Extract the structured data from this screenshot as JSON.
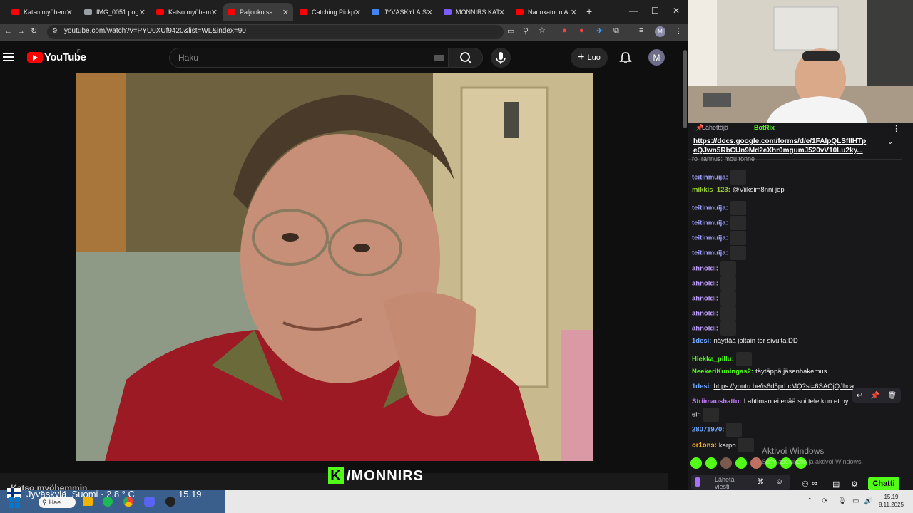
{
  "browser": {
    "tabs": [
      {
        "title": "Katso myöhemmin",
        "color": "#ff0000",
        "active": false
      },
      {
        "title": "IMG_0051.png",
        "color": "#9aa0a6",
        "active": false
      },
      {
        "title": "Katso myöhemmin",
        "color": "#ff0000",
        "active": false
      },
      {
        "title": "Paljonko sa",
        "color": "#ff0000",
        "active": true
      },
      {
        "title": "Catching Pickp",
        "color": "#ff0000",
        "active": false
      },
      {
        "title": "JYVÄSKYLÄ SÖ",
        "color": "#4285f4",
        "active": false
      },
      {
        "title": "MONNIRS KAT",
        "color": "#7b5cff",
        "active": false
      },
      {
        "title": "Narinkatorin A",
        "color": "#ff0000",
        "active": false
      }
    ],
    "url": "youtube.com/watch?v=PYU0XUf9420&list=WL&index=90",
    "profile_initial": "M"
  },
  "youtube": {
    "logo_text": "YouTube",
    "region": "FI",
    "search_placeholder": "Haku",
    "create_label": "Luo",
    "avatar_initial": "M",
    "watch_later_label": "Katso myöhemmin"
  },
  "overlay": {
    "brand_letter": "K",
    "channel_text": "/MONNIRS"
  },
  "chat": {
    "pinned_by_label": "Lähettäjä",
    "pinned_by_user": "BotRix",
    "pinned_link": "https://docs.google.com/forms/d/e/1FAIpQLSfIlHTp eQJwn5RbCUn9Md2eXhr0mgumJ520vV10Lu2ky...",
    "partial_line": "ro_rannus: mou tonne",
    "messages": [
      {
        "user": "teitinmuija:",
        "color": "#a0a0ff",
        "text": "",
        "emote": true
      },
      {
        "user": "mikkis_123:",
        "color": "#9acd32",
        "text": "@Viiksim8nni jep",
        "emote": false
      },
      {
        "user": "teitinmuija:",
        "color": "#a0a0ff",
        "text": "",
        "emote": true
      },
      {
        "user": "teitinmuija:",
        "color": "#a0a0ff",
        "text": "",
        "emote": true
      },
      {
        "user": "teitinmuija:",
        "color": "#a0a0ff",
        "text": "",
        "emote": true
      },
      {
        "user": "teitinmuija:",
        "color": "#a0a0ff",
        "text": "",
        "emote": true
      },
      {
        "user": "ahnoldi:",
        "color": "#c0a0ff",
        "text": "",
        "emote": true
      },
      {
        "user": "ahnoldi:",
        "color": "#c0a0ff",
        "text": "",
        "emote": true
      },
      {
        "user": "ahnoldi:",
        "color": "#c0a0ff",
        "text": "",
        "emote": true
      },
      {
        "user": "ahnoldi:",
        "color": "#c0a0ff",
        "text": "",
        "emote": true
      },
      {
        "user": "ahnoldi:",
        "color": "#c0a0ff",
        "text": "",
        "emote": true
      },
      {
        "user": "1desi:",
        "color": "#6fa8ff",
        "text": "näyttää joltain tor sivulta:DD",
        "emote": false
      },
      {
        "user": "Hiekka_pillu:",
        "color": "#53fc18",
        "text": "",
        "emote": true
      },
      {
        "user": "NeekeriKuningas2:",
        "color": "#53fc18",
        "text": "täytäppä jäsenhakemus",
        "emote": false
      },
      {
        "user": "1desi:",
        "color": "#6fa8ff",
        "text": "https://youtu.be/is6d5prhcMQ?si=6SAOjQJhca...",
        "emote": false
      },
      {
        "user": "Striimaushattu:",
        "color": "#c77dff",
        "text": "Lahtiman ei enää soittele kun et hy...",
        "emote": false
      },
      {
        "user": "",
        "color": "#ffffff",
        "text": "eih",
        "emote": true
      },
      {
        "user": "28071970:",
        "color": "#6fa8ff",
        "text": "",
        "emote": true
      },
      {
        "user": "or1ons:",
        "color": "#ffb020",
        "text": "karpo",
        "emote": true
      }
    ],
    "input_placeholder": "Lähetä viesti",
    "chat_button": "Chatti"
  },
  "windows_watermark": {
    "title": "Aktivoi Windows",
    "subtitle": "Siirry asetuksiin ja aktivoi Windows."
  },
  "taskbar": {
    "weather_text": "Jyväskylä, Suomi · 2.8 ° C",
    "weather_time": "15.19",
    "search_label": "Hae",
    "time": "15.19",
    "date": "8.11.2025"
  }
}
